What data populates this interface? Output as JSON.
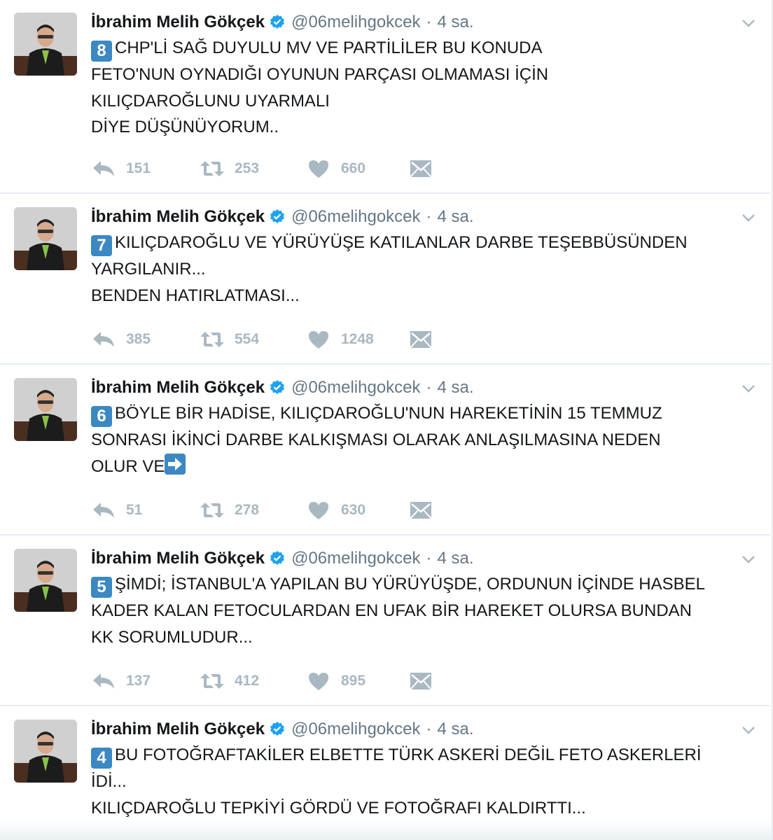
{
  "colors": {
    "name": "#14171a",
    "secondary": "#657786",
    "action": "#aab8c2",
    "divider": "#e6ecf0",
    "verified": "#1da1f2",
    "keycap": "#3b88c3"
  },
  "icons": {
    "verified": "verified-badge-icon",
    "caret": "chevron-down-icon",
    "reply": "reply-icon",
    "retweet": "retweet-icon",
    "like": "heart-icon",
    "dm": "envelope-icon",
    "arrow": "right-arrow-emoji-icon"
  },
  "tweets": [
    {
      "name": "İbrahim Melih Gökçek",
      "handle": "@06melihgokcek",
      "separator": "·",
      "time": "4 sa.",
      "number": "8",
      "lines": [
        "CHP'Lİ SAĞ DUYULU MV VE PARTİLİLER BU KONUDA",
        "FETO'NUN OYNADIĞI OYUNUN PARÇASI OLMAMASI İÇİN",
        "KILIÇDAROĞLUNU UYARMALI",
        "DİYE DÜŞÜNÜYORUM.."
      ],
      "replies": "151",
      "retweets": "253",
      "likes": "660"
    },
    {
      "name": "İbrahim Melih Gökçek",
      "handle": "@06melihgokcek",
      "separator": "·",
      "time": "4 sa.",
      "number": "7",
      "lines": [
        "KILIÇDAROĞLU VE YÜRÜYÜŞE KATILANLAR DARBE TEŞEBBÜSÜNDEN",
        "YARGILANIR...",
        "BENDEN HATIRLATMASI..."
      ],
      "replies": "385",
      "retweets": "554",
      "likes": "1248"
    },
    {
      "name": "İbrahim Melih Gökçek",
      "handle": "@06melihgokcek",
      "separator": "·",
      "time": "4 sa.",
      "number": "6",
      "lines": [
        "BÖYLE BİR HADİSE, KILIÇDAROĞLU'NUN HAREKETİNİN 15 TEMMUZ",
        "SONRASI İKİNCİ DARBE KALKIŞMASI OLARAK ANLAŞILMASINA NEDEN",
        "OLUR VE"
      ],
      "replies": "51",
      "retweets": "278",
      "likes": "630"
    },
    {
      "name": "İbrahim Melih Gökçek",
      "handle": "@06melihgokcek",
      "separator": "·",
      "time": "4 sa.",
      "number": "5",
      "lines": [
        "ŞİMDİ; İSTANBUL'A YAPILAN BU YÜRÜYÜŞDE, ORDUNUN İÇİNDE HASBEL",
        "KADER KALAN FETOCULARDAN EN UFAK BİR HAREKET OLURSA BUNDAN",
        "KK SORUMLUDUR..."
      ],
      "replies": "137",
      "retweets": "412",
      "likes": "895"
    },
    {
      "name": "İbrahim Melih Gökçek",
      "handle": "@06melihgokcek",
      "separator": "·",
      "time": "4 sa.",
      "number": "4",
      "lines": [
        "BU FOTOĞRAFTAKİLER ELBETTE TÜRK ASKERİ DEĞİL FETO ASKERLERİ",
        "İDİ...",
        "KILIÇDAROĞLU TEPKİYİ GÖRDÜ VE FOTOĞRAFI KALDIRTTI..."
      ]
    }
  ]
}
